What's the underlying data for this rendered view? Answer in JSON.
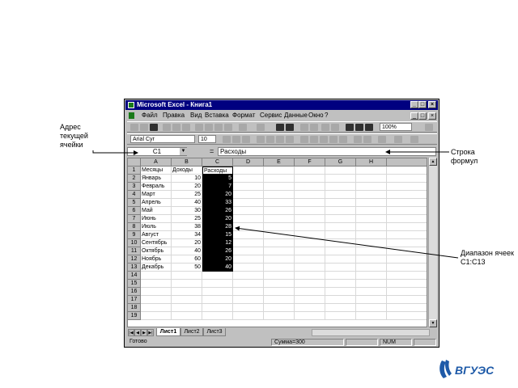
{
  "annotations": {
    "address": "Адрес текущей ячейки",
    "formula_bar": "Строка формул",
    "range": "Диапазон ячеек C1:C13"
  },
  "window": {
    "title": "Microsoft Excel - Книга1",
    "controls": [
      "_",
      "□",
      "×"
    ],
    "doc_controls": [
      "_",
      "□",
      "×"
    ]
  },
  "menu": [
    "Файл",
    "Правка",
    "Вид",
    "Вставка",
    "Формат",
    "Сервис",
    "Данные",
    "Окно",
    "?"
  ],
  "toolbar": {
    "font_name": "Arial Cyr",
    "font_size": "10",
    "zoom": "100%"
  },
  "formula_bar": {
    "name_box": "C1",
    "equals": "=",
    "content": "Расходы"
  },
  "columns": [
    "A",
    "B",
    "C",
    "D",
    "E",
    "F",
    "G",
    "H"
  ],
  "rows": [
    "1",
    "2",
    "3",
    "4",
    "5",
    "6",
    "7",
    "8",
    "9",
    "10",
    "11",
    "12",
    "13",
    "14",
    "15",
    "16",
    "17",
    "18",
    "19"
  ],
  "table": [
    {
      "a": "Месяцы",
      "b": "Доходы",
      "c": "Расходы"
    },
    {
      "a": "Январь",
      "b": "10",
      "c": "5"
    },
    {
      "a": "Февраль",
      "b": "20",
      "c": "7"
    },
    {
      "a": "Март",
      "b": "25",
      "c": "20"
    },
    {
      "a": "Апрель",
      "b": "40",
      "c": "33"
    },
    {
      "a": "Май",
      "b": "30",
      "c": "26"
    },
    {
      "a": "Июнь",
      "b": "25",
      "c": "20"
    },
    {
      "a": "Июль",
      "b": "38",
      "c": "28"
    },
    {
      "a": "Август",
      "b": "34",
      "c": "15"
    },
    {
      "a": "Сентябрь",
      "b": "20",
      "c": "12"
    },
    {
      "a": "Октябрь",
      "b": "40",
      "c": "26"
    },
    {
      "a": "Ноябрь",
      "b": "60",
      "c": "20"
    },
    {
      "a": "Декабрь",
      "b": "50",
      "c": "40"
    }
  ],
  "sheets": [
    "Лист1",
    "Лист2",
    "Лист3"
  ],
  "status": {
    "ready": "Готово",
    "sum": "Сумма=300",
    "num": "NUM"
  },
  "logo_text": "ВГУЭС"
}
